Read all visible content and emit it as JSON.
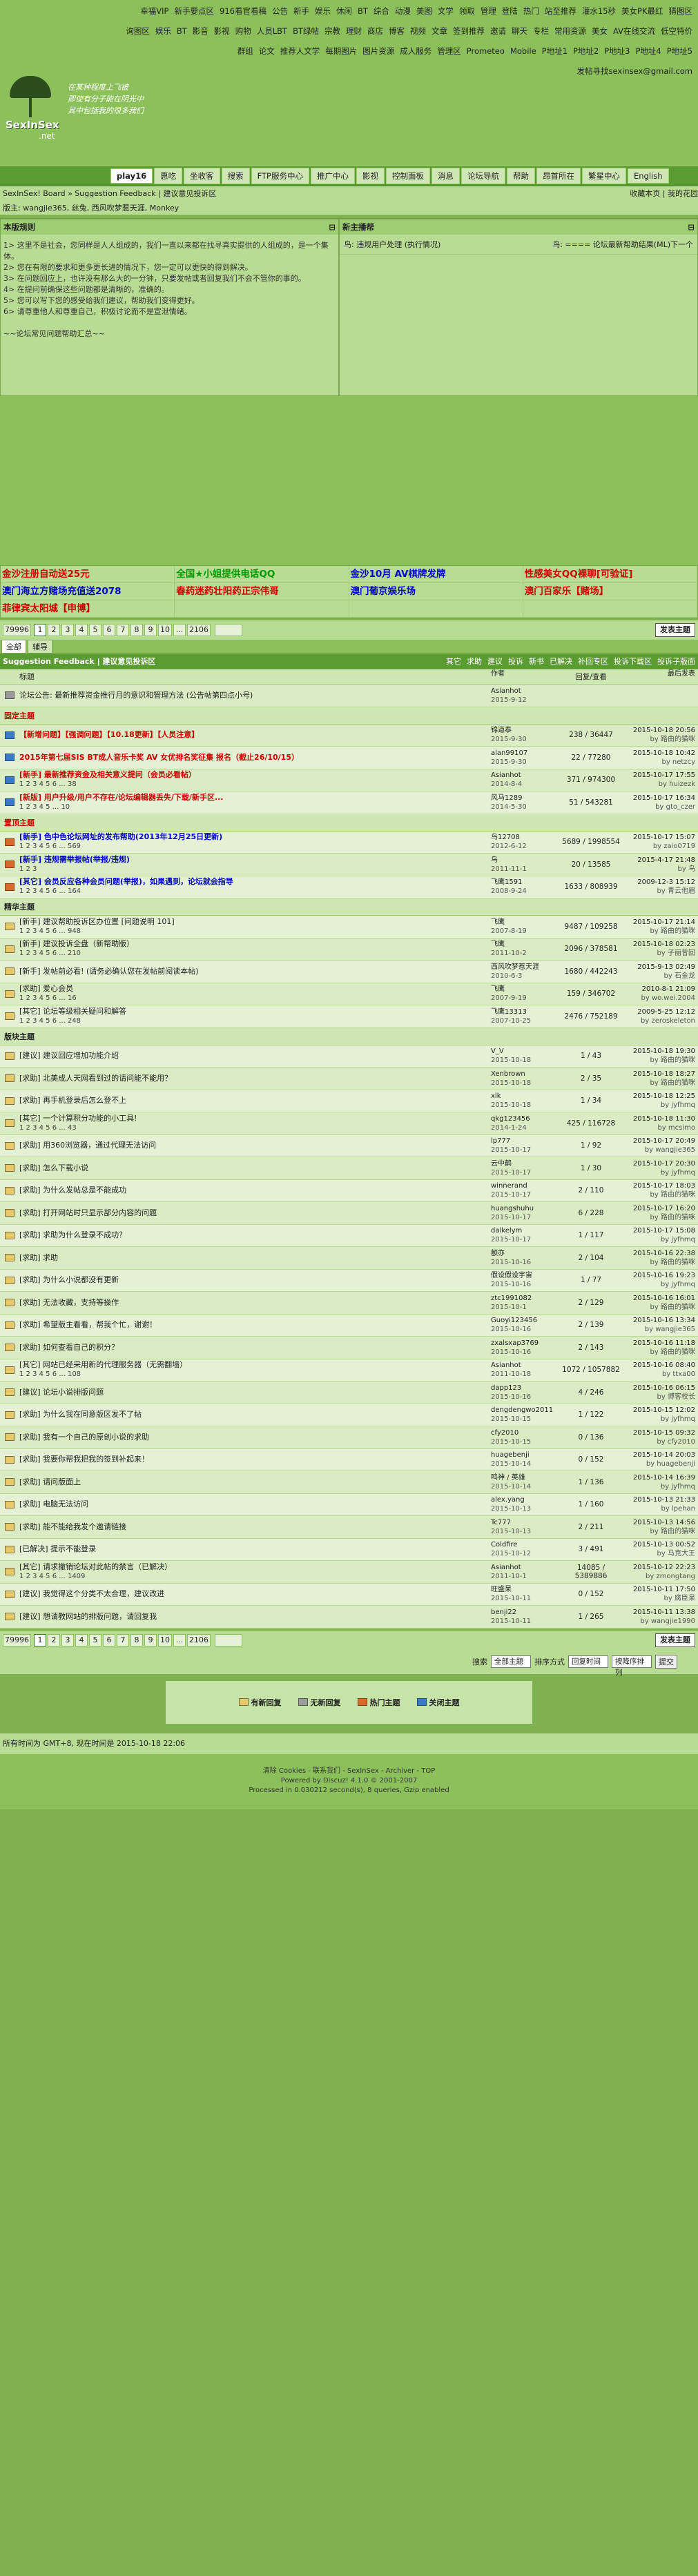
{
  "toplinks": [
    "幸福VIP",
    "新手要点区",
    "916看官看稿",
    "公告",
    "新手",
    "娱乐",
    "休闲",
    "BT",
    "综合",
    "动漫",
    "美图",
    "文学",
    "领取",
    "管理",
    "登陆",
    "热门",
    "站至推荐",
    "灌水15秒",
    "美女PK最红",
    "猜图区",
    "询图区",
    "娱乐",
    "BT",
    "影音",
    "影视",
    "购物",
    "人员LBT",
    "BT绿帖",
    "宗教",
    "理财",
    "商店",
    "博客",
    "视频",
    "文章",
    "签到推荐",
    "邀请",
    "聊天",
    "专栏",
    "常用资源",
    "美女",
    "AV在线交流",
    "低空特价",
    "群组",
    "论文",
    "推荐人文学",
    "每期图片",
    "图片资源",
    "成人服务",
    "管理区",
    "Prometeo",
    "Mobile",
    "P地址1",
    "P地址2",
    "P地址3",
    "P地址4",
    "P地址5",
    "发帖寻找sexinsex@gmail.com"
  ],
  "logo": {
    "name": "SexInSex",
    "net": ".net",
    "slogan": [
      "在某种程度上飞被",
      "即使有分子能在阴光中",
      "其中包括我的很多我们"
    ]
  },
  "nav": [
    "play16",
    "惠吃",
    "坐收客",
    "搜索",
    "FTP服务中心",
    "推广中心",
    "影视",
    "控制面板",
    "消息",
    "论坛导航",
    "帮助",
    "昂首所在",
    "繁星中心",
    "English"
  ],
  "bread": {
    "left": "SexInSex! Board » Suggestion Feedback | 建议意见投诉区",
    "right": "收藏本页 | 我的花园"
  },
  "mods": "版主: wangjie365, 丝兔, 西风吹梦惹天涯, Monkey",
  "notice": {
    "title": "本版规则",
    "lines": [
      "1> 这里不是社会，您同样是人人组成的，我们一直以来都在找寻真实提供的人组成的，是一个集体。",
      "2> 您在有限的要求和更多更长进的情况下，您一定可以更快的得到解决。",
      "3> 在问题回应上，也许没有那么大的一分钟，只要发帖或者回复我们不会不管你的事的。",
      "4> 在提问前确保这些问题都是清晰的，准确的。",
      "5> 您可以写下您的感受给我们建议，帮助我们变得更好。",
      "6> 请尊重他人和尊重自己，积极讨论而不是宣泄情绪。",
      "",
      "~~论坛常见问题帮助汇总~~"
    ]
  },
  "rules": {
    "title": "新主播帮",
    "items": [
      [
        "鸟: 违规用户处理 (执行情况)",
        "鸟: ==== 论坛最新帮助结果(ML)下一个"
      ]
    ]
  },
  "ads": [
    "金沙注册自动送25元",
    "全国★小姐提供电话QQ",
    "金沙10月 AV棋牌发牌",
    "性感美女QQ裸聊[可验证]",
    "澳门海立方赌场充值送2078",
    "春药迷药壮阳药正宗伟哥",
    "澳门葡京娱乐场",
    "澳门百家乐【赌场】",
    "菲律宾太阳城【申博】",
    "",
    "",
    ""
  ],
  "pager": {
    "total": "79996",
    "pages": [
      "1",
      "2",
      "3",
      "4",
      "5",
      "6",
      "7",
      "8",
      "9",
      "10",
      "...",
      "2106"
    ],
    "new_btn": "发表主题"
  },
  "tabs": [
    "全部",
    "辅导"
  ],
  "forum": {
    "title": "Suggestion Feedback | 建议意见投诉区",
    "filters": [
      "其它",
      "求助",
      "建议",
      "投诉",
      "新书",
      "已解决",
      "补回专区",
      "投诉下载区",
      "投诉子版面"
    ]
  },
  "thead": {
    "title": "标题",
    "author": "作者",
    "reply": "回复/查看",
    "last": "最后发表"
  },
  "sections": {
    "global": "固定主题",
    "top": "置顶主题",
    "hot": "精华主题",
    "new": "版块主题"
  },
  "rows": [
    {
      "sec": "",
      "icon": "poll",
      "t": "论坛公告: 最新推荐资金推行月的意识和管理方法 (公告帖第四点小号)",
      "pg": "",
      "a": "Asianhot",
      "ad": "2015-9-12",
      "r": "",
      "l": "",
      "ld": ""
    },
    {
      "sec": "global",
      "icon": "top",
      "t": "【新增问题】【强调问题】【10.18更新】【人员注意】",
      "pg": "",
      "a": "锦道泰",
      "ad": "2015-9-30",
      "r": "238 / 36447",
      "l": "2015-10-18 20:56",
      "ld": "by 路由的猫咪"
    },
    {
      "sec": "",
      "icon": "top",
      "t": "2015年第七届SIS BT成人音乐卡奖 AV 女优排名奖征集 报名（截止26/10/15）",
      "pg": "",
      "a": "alan99107",
      "ad": "2015-9-30",
      "r": "22 / 77280",
      "l": "2015-10-18 10:42",
      "ld": "by netzcy"
    },
    {
      "sec": "",
      "icon": "top",
      "t": "[新手] 最新推荐资金及相关意义提问（会员必看帖）",
      "pg": "1 2 3 4 5 6 ... 38",
      "a": "Asianhot",
      "ad": "2014-8-4",
      "r": "371 / 974300",
      "l": "2015-10-17 17:55",
      "ld": "by huizezk"
    },
    {
      "sec": "",
      "icon": "top",
      "t": "[新版] 用户升级/用户不存在/论坛编辑器丢失/下载/新手区...",
      "pg": "1 2 3 4 5 ... 10",
      "a": "风马1289",
      "ad": "2014-5-30",
      "r": "51 / 543281",
      "l": "2015-10-17 16:34",
      "ld": "by gto_czer"
    },
    {
      "sec": "top",
      "icon": "hot",
      "t": "[新手] 色中色论坛网址的发布帮助(2013年12月25日更新)",
      "pg": "1 2 3 4 5 6 ... 569",
      "a": "鸟12708",
      "ad": "2012-6-12",
      "r": "5689 / 1998554",
      "l": "2015-10-17 15:07",
      "ld": "by zaio0719"
    },
    {
      "sec": "",
      "icon": "hot",
      "t": "[新手] 违规需举报帖(举报/违规)",
      "pg": "1 2 3",
      "a": "鸟",
      "ad": "2011-11-1",
      "r": "20 / 13585",
      "l": "2015-4-17 21:48",
      "ld": "by 鸟"
    },
    {
      "sec": "",
      "icon": "hot",
      "t": "[其它] 会员反应各种会员问题(举报)，如果遇到，论坛就会指导",
      "pg": "1 2 3 4 5 6 ... 164",
      "a": "飞鹰1591",
      "ad": "2008-9-24",
      "r": "1633 / 808939",
      "l": "2009-12-3 15:12",
      "ld": "by 青云他眉"
    },
    {
      "sec": "hot",
      "icon": "",
      "t": "[新手] 建议帮助投诉区办位置 [问题说明 101]",
      "pg": "1 2 3 4 5 6 ... 948",
      "a": "飞鹰",
      "ad": "2007-8-19",
      "r": "9487 / 109258",
      "l": "2015-10-17 21:14",
      "ld": "by 路由的猫咪"
    },
    {
      "sec": "",
      "icon": "",
      "t": "[新手] 建议投诉全盘（新帮助版）",
      "pg": "1 2 3 4 5 6 ... 210",
      "a": "飞鹰",
      "ad": "2011-10-2",
      "r": "2096 / 378581",
      "l": "2015-10-18 02:23",
      "ld": "by 子丽昔回"
    },
    {
      "sec": "",
      "icon": "",
      "t": "[新手] 发帖前必看! (请务必确认您在发帖前阅读本帖)",
      "pg": "",
      "a": "西风吹梦惹天涯",
      "ad": "2010-6-3",
      "r": "1680 / 442243",
      "l": "2015-9-13 02:49",
      "ld": "by 石金龙"
    },
    {
      "sec": "",
      "icon": "",
      "t": "[求助] 爱心会员",
      "pg": "1 2 3 4 5 6 ... 16",
      "a": "飞鹰",
      "ad": "2007-9-19",
      "r": "159 / 346702",
      "l": "2010-8-1 21:09",
      "ld": "by wo.wei.2004"
    },
    {
      "sec": "",
      "icon": "",
      "t": "[其它] 论坛等级相关疑问和解答",
      "pg": "1 2 3 4 5 6 ... 248",
      "a": "飞鹰13313",
      "ad": "2007-10-25",
      "r": "2476 / 752189",
      "l": "2009-5-25 12:12",
      "ld": "by zeroskeleton"
    },
    {
      "sec": "new",
      "icon": "",
      "t": "[建议] 建议回应增加功能介绍",
      "pg": "",
      "a": "V_V",
      "ad": "2015-10-18",
      "r": "1 / 43",
      "l": "2015-10-18 19:30",
      "ld": "by 路由的猫咪"
    },
    {
      "sec": "",
      "icon": "",
      "t": "[求助] 北美成人天网看到过的请问能不能用？",
      "pg": "",
      "a": "Xenbrown",
      "ad": "2015-10-18",
      "r": "2 / 35",
      "l": "2015-10-18 18:27",
      "ld": "by 路由的猫咪"
    },
    {
      "sec": "",
      "icon": "",
      "t": "[求助] 再手机登录后怎么登不上",
      "pg": "",
      "a": "xlk",
      "ad": "2015-10-18",
      "r": "1 / 34",
      "l": "2015-10-18 12:25",
      "ld": "by jyfhmq"
    },
    {
      "sec": "",
      "icon": "",
      "t": "[其它] 一个计算积分功能的小工具!",
      "pg": "1 2 3 4 5 6 ... 43",
      "a": "qkg123456",
      "ad": "2014-1-24",
      "r": "425 / 116728",
      "l": "2015-10-18 11:30",
      "ld": "by mcsimo"
    },
    {
      "sec": "",
      "icon": "",
      "t": "[求助] 用360浏览器，通过代理无法访问",
      "pg": "",
      "a": "lp777",
      "ad": "2015-10-17",
      "r": "1 / 92",
      "l": "2015-10-17 20:49",
      "ld": "by wangjie365"
    },
    {
      "sec": "",
      "icon": "",
      "t": "[求助] 怎么下载小说",
      "pg": "",
      "a": "云中鹤",
      "ad": "2015-10-17",
      "r": "1 / 30",
      "l": "2015-10-17 20:30",
      "ld": "by jyfhmq"
    },
    {
      "sec": "",
      "icon": "",
      "t": "[求助] 为什么发帖总是不能成功",
      "pg": "",
      "a": "winnerand",
      "ad": "2015-10-17",
      "r": "2 / 110",
      "l": "2015-10-17 18:03",
      "ld": "by 路由的猫咪"
    },
    {
      "sec": "",
      "icon": "",
      "t": "[求助] 打开网站时只显示部分内容的问题",
      "pg": "",
      "a": "huangshuhu",
      "ad": "2015-10-17",
      "r": "6 / 228",
      "l": "2015-10-17 16:20",
      "ld": "by 路由的猫咪"
    },
    {
      "sec": "",
      "icon": "",
      "t": "[求助] 求助为什么登录不成功？",
      "pg": "",
      "a": "dalkelym",
      "ad": "2015-10-17",
      "r": "1 / 117",
      "l": "2015-10-17 15:08",
      "ld": "by jyfhmq"
    },
    {
      "sec": "",
      "icon": "",
      "t": "[求助] 求助",
      "pg": "",
      "a": "额亦",
      "ad": "2015-10-16",
      "r": "2 / 104",
      "l": "2015-10-16 22:38",
      "ld": "by 路由的猫咪"
    },
    {
      "sec": "",
      "icon": "",
      "t": "[求助] 为什么小说都没有更新",
      "pg": "",
      "a": "假设假设宇宙",
      "ad": "2015-10-16",
      "r": "1 / 77",
      "l": "2015-10-16 19:23",
      "ld": "by jyfhmq"
    },
    {
      "sec": "",
      "icon": "",
      "t": "[求助] 无法收藏，支持等操作",
      "pg": "",
      "a": "ztc1991082",
      "ad": "2015-10-1",
      "r": "2 / 129",
      "l": "2015-10-16 16:01",
      "ld": "by 路由的猫咪"
    },
    {
      "sec": "",
      "icon": "",
      "t": "[求助] 希望版主看看，帮我个忙，谢谢！",
      "pg": "",
      "a": "Guoyi123456",
      "ad": "2015-10-16",
      "r": "2 / 139",
      "l": "2015-10-16 13:34",
      "ld": "by wangjie365"
    },
    {
      "sec": "",
      "icon": "",
      "t": "[求助] 如何查看自己的积分？",
      "pg": "",
      "a": "zxalsxap3769",
      "ad": "2015-10-16",
      "r": "2 / 143",
      "l": "2015-10-16 11:18",
      "ld": "by 路由的猫咪"
    },
    {
      "sec": "",
      "icon": "",
      "t": "[其它] 网站已经采用新的代理服务器（无需翻墙）",
      "pg": "1 2 3 4 5 6 ... 108",
      "a": "Asianhot",
      "ad": "2011-10-18",
      "r": "1072 / 1057882",
      "l": "2015-10-16 08:40",
      "ld": "by ttxa00"
    },
    {
      "sec": "",
      "icon": "",
      "t": "[建议] 论坛小说排版问题",
      "pg": "",
      "a": "dapp123",
      "ad": "2015-10-16",
      "r": "4 / 246",
      "l": "2015-10-16 06:15",
      "ld": "by 博客校长"
    },
    {
      "sec": "",
      "icon": "",
      "t": "[求助] 为什么我在同意版区发不了帖",
      "pg": "",
      "a": "dengdengwo2011",
      "ad": "2015-10-15",
      "r": "1 / 122",
      "l": "2015-10-15 12:02",
      "ld": "by jyfhmq"
    },
    {
      "sec": "",
      "icon": "",
      "t": "[求助] 我有一个自己的原创小说的求助",
      "pg": "",
      "a": "cfy2010",
      "ad": "2015-10-15",
      "r": "0 / 136",
      "l": "2015-10-15 09:32",
      "ld": "by cfy2010"
    },
    {
      "sec": "",
      "icon": "",
      "t": "[求助] 我要你帮我把我的签到补起来！",
      "pg": "",
      "a": "huagebenji",
      "ad": "2015-10-14",
      "r": "0 / 152",
      "l": "2015-10-14 20:03",
      "ld": "by huagebenji"
    },
    {
      "sec": "",
      "icon": "",
      "t": "[求助] 请问版面上",
      "pg": "",
      "a": "鸣神 / 英雄",
      "ad": "2015-10-14",
      "r": "1 / 136",
      "l": "2015-10-14 16:39",
      "ld": "by jyfhmq"
    },
    {
      "sec": "",
      "icon": "",
      "t": "[求助] 电脑无法访问",
      "pg": "",
      "a": "alex.yang",
      "ad": "2015-10-13",
      "r": "1 / 160",
      "l": "2015-10-13 21:33",
      "ld": "by lpehan"
    },
    {
      "sec": "",
      "icon": "",
      "t": "[求助] 能不能给我发个邀请链接",
      "pg": "",
      "a": "Tc777",
      "ad": "2015-10-13",
      "r": "2 / 211",
      "l": "2015-10-13 14:56",
      "ld": "by 路由的猫咪"
    },
    {
      "sec": "",
      "icon": "",
      "t": "[已解决] 提示不能登录",
      "pg": "",
      "a": "Coldfire",
      "ad": "2015-10-12",
      "r": "3 / 491",
      "l": "2015-10-13 00:52",
      "ld": "by 马克大王"
    },
    {
      "sec": "",
      "icon": "",
      "t": "[其它] 请求撤销论坛对此帖的禁言（已解决）",
      "pg": "1 2 3 4 5 6 ... 1409",
      "a": "Asianhot",
      "ad": "2011-10-1",
      "r": "14085 / 5389886",
      "l": "2015-10-12 22:23",
      "ld": "by zmongtang"
    },
    {
      "sec": "",
      "icon": "",
      "t": "[建议] 我觉得这个分类不太合理，建议改进",
      "pg": "",
      "a": "旺盛呆",
      "ad": "2015-10-11",
      "r": "0 / 152",
      "l": "2015-10-11 17:50",
      "ld": "by 腐臣呆"
    },
    {
      "sec": "",
      "icon": "",
      "t": "[建议] 想请教网站的排版问题，请回复我",
      "pg": "",
      "a": "benji22",
      "ad": "2015-10-11",
      "r": "1 / 265",
      "l": "2015-10-11 13:38",
      "ld": "by wangjie1990"
    }
  ],
  "search": {
    "label": "搜索",
    "s1": "全部主题",
    "s2": "排序方式",
    "s3": "回复时间",
    "s4": "按降序排列",
    "btn": "提交"
  },
  "legend": [
    "有新回复",
    "无新回复",
    "热门主题",
    "关闭主题"
  ],
  "footer1": "清除Cookies - 联系我们 - SexInSex - Archiver - TOP",
  "footer2": [
    "清除 Cookies - 联系我们 - SexInSex - Archiver - TOP",
    "Powered by Discuz! 4.1.0 © 2001-2007",
    "Processed in 0.030212 second(s), 8 queries, Gzip enabled"
  ],
  "timefoot": "所有时间为 GMT+8, 现在时间是 2015-10-18 22:06"
}
